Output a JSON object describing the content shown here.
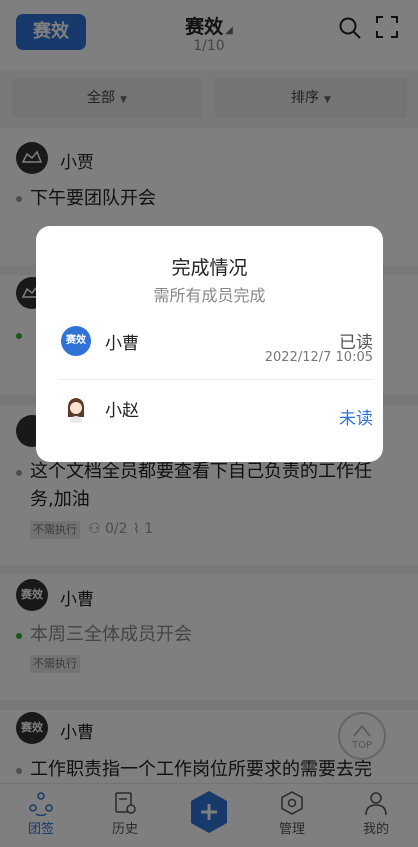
{
  "header": {
    "logo_text": "赛效",
    "title": "赛效",
    "page_indicator": "1/10"
  },
  "filters": {
    "all_label": "全部",
    "sort_label": "排序"
  },
  "posts": [
    {
      "author": "小贾",
      "content": "下午要团队开会",
      "tag": ""
    },
    {
      "author": "",
      "content": "",
      "tag": ""
    },
    {
      "author": "",
      "content": "这个文档全员都要查看下自己负责的工作任务,加油",
      "tag": "不需执行",
      "members": "0/2",
      "attachments": "1"
    },
    {
      "avatar_text": "赛效",
      "author": "小曹",
      "content": "本周三全体成员开会",
      "tag": "不需执行"
    },
    {
      "avatar_text": "赛效",
      "author": "小曹",
      "content": "工作职责指一个工作岗位所要求的需要去完"
    }
  ],
  "top_button": {
    "label": "TOP"
  },
  "bottom_nav": {
    "tuanqian": "团签",
    "history": "历史",
    "manage": "管理",
    "mine": "我的"
  },
  "dialog": {
    "title": "完成情况",
    "subtitle": "需所有成员完成",
    "rows": [
      {
        "avatar_text": "赛效",
        "name": "小曹",
        "status": "已读",
        "time": "2022/12/7 10:05"
      },
      {
        "name": "小赵",
        "status": "未读"
      }
    ]
  },
  "colors": {
    "brand": "#2f73d9",
    "read_status": "#555555",
    "unread_status": "#2f73d9"
  }
}
